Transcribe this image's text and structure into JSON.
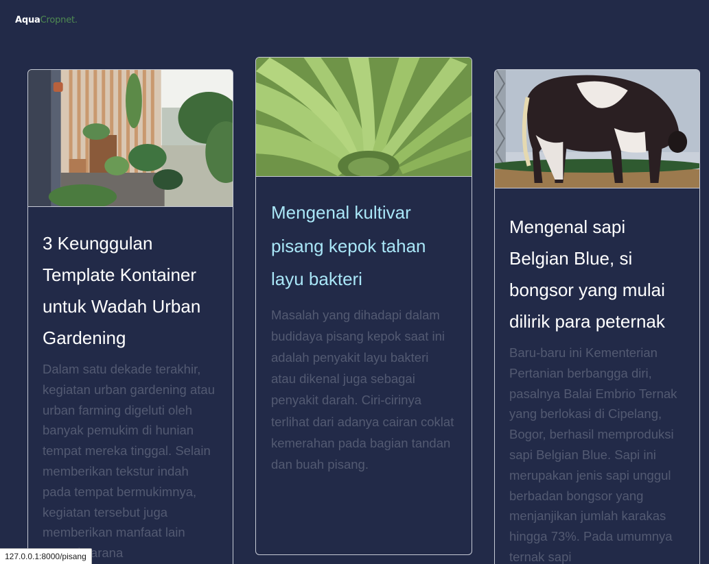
{
  "brand": {
    "part1": "Aqua",
    "part2": "Cropnet."
  },
  "posts": [
    {
      "image": "balcony-urban-garden-photo",
      "title": "3 Keunggulan Template Kontainer untuk Wadah Urban Gardening",
      "excerpt": "Dalam satu dekade terakhir, kegiatan urban gardening atau urban farming digeluti oleh banyak pemukim di hunian tempat mereka tinggal. Selain memberikan tekstur indah pada tempat bermukimnya, kegiatan tersebut juga memberikan manfaat lain seperti sarana"
    },
    {
      "image": "green-banana-bunch-photo",
      "title": "Mengenal kultivar pisang kepok tahan layu bakteri",
      "excerpt": "Masalah yang dihadapi dalam budidaya pisang kepok saat ini adalah penyakit layu bakteri atau dikenal juga sebagai penyakit darah. Ciri-cirinya terlihat dari adanya cairan coklat kemerahan pada bagian tandan dan buah pisang."
    },
    {
      "image": "belgian-blue-cow-photo",
      "title": "Mengenal sapi Belgian Blue, si bongsor yang mulai dilirik para peternak",
      "excerpt": "Baru-baru ini Kementerian Pertanian berbangga diri, pasalnya Balai Embrio Ternak yang berlokasi di Cipelang, Bogor, berhasil memproduksi sapi Belgian Blue. Sapi ini merupakan jenis sapi unggul berbadan bongsor yang menjanjikan jumlah karakas hingga 73%. Pada umumnya ternak sapi"
    }
  ],
  "status_url": "127.0.0.1:8000/pisang",
  "colors": {
    "background": "#222a48",
    "card_border": "#c7cbd6",
    "hover_title": "#a9e6f7",
    "excerpt_text": "#535a72",
    "brand_accent": "#4f8a52"
  }
}
